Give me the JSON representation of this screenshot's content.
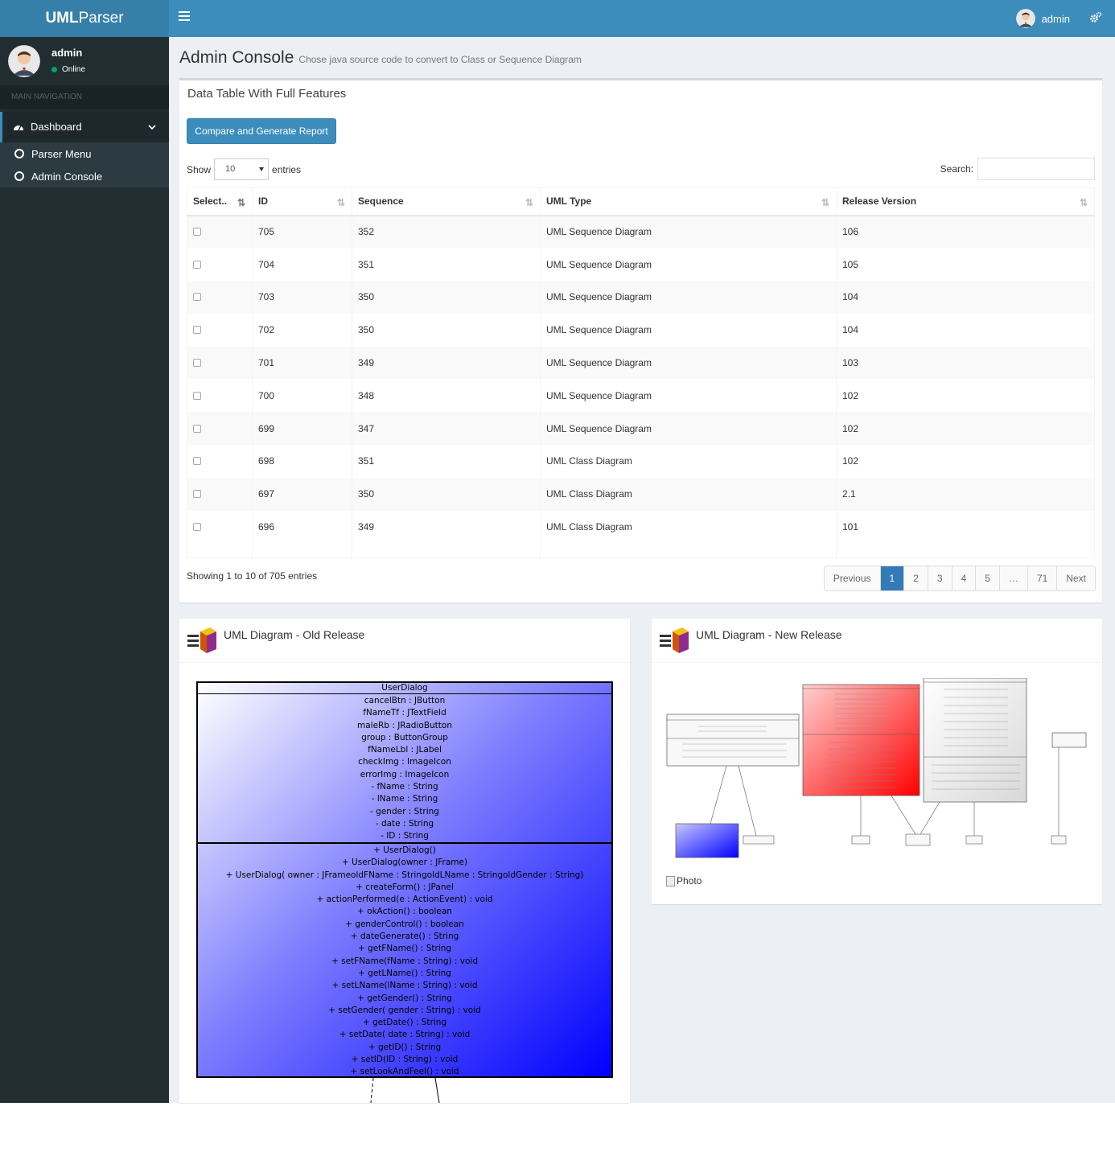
{
  "app": {
    "logo_bold": "UML",
    "logo_rest": "Parser"
  },
  "topbar": {
    "username": "admin"
  },
  "sidebar": {
    "username": "admin",
    "status": "Online",
    "nav_header": "MAIN NAVIGATION",
    "dashboard_label": "Dashboard",
    "items": [
      {
        "label": "Parser Menu"
      },
      {
        "label": "Admin Console"
      }
    ]
  },
  "page": {
    "title": "Admin Console",
    "subtitle": "Chose java source code to convert to Class or Sequence Diagram"
  },
  "datatable": {
    "title": "Data Table With Full Features",
    "compare_button": "Compare and Generate Report",
    "show_label": "Show",
    "entries_value": "10",
    "entries_label": "entries",
    "search_label": "Search:",
    "search_value": "",
    "columns": [
      "Select..",
      "ID",
      "Sequence",
      "UML Type",
      "Release Version"
    ],
    "rows": [
      {
        "id": "705",
        "sequence": "352",
        "uml_type": "UML Sequence Diagram",
        "release": "106"
      },
      {
        "id": "704",
        "sequence": "351",
        "uml_type": "UML Sequence Diagram",
        "release": "105"
      },
      {
        "id": "703",
        "sequence": "350",
        "uml_type": "UML Sequence Diagram",
        "release": "104"
      },
      {
        "id": "702",
        "sequence": "350",
        "uml_type": "UML Sequence Diagram",
        "release": "104"
      },
      {
        "id": "701",
        "sequence": "349",
        "uml_type": "UML Sequence Diagram",
        "release": "103"
      },
      {
        "id": "700",
        "sequence": "348",
        "uml_type": "UML Sequence Diagram",
        "release": "102"
      },
      {
        "id": "699",
        "sequence": "347",
        "uml_type": "UML Sequence Diagram",
        "release": "102"
      },
      {
        "id": "698",
        "sequence": "351",
        "uml_type": "UML Class Diagram",
        "release": "102"
      },
      {
        "id": "697",
        "sequence": "350",
        "uml_type": "UML Class Diagram",
        "release": "2.1"
      },
      {
        "id": "696",
        "sequence": "349",
        "uml_type": "UML Class Diagram",
        "release": "101"
      }
    ],
    "info": "Showing 1 to 10 of 705 entries",
    "pagination": [
      "Previous",
      "1",
      "2",
      "3",
      "4",
      "5",
      "…",
      "71",
      "Next"
    ]
  },
  "old_release": {
    "title": "UML Diagram - Old Release",
    "class_name": "UserDialog",
    "attributes": [
      "cancelBtn : JButton",
      "fNameTf : JTextField",
      "maleRb : JRadioButton",
      "group : ButtonGroup",
      "fNameLbl : JLabel",
      "checkImg : ImageIcon",
      "errorImg : ImageIcon",
      "- fName : String",
      "- lName : String",
      "- gender : String",
      "- date : String",
      "- ID : String"
    ],
    "operations": [
      "+ UserDialog()",
      "+ UserDialog(owner : JFrame)",
      "+ UserDialog( owner : JFrameoldFName : StringoldLName : StringoldGender : String)",
      "+ createForm() : JPanel",
      "+ actionPerformed(e : ActionEvent) : void",
      "+ okAction() : boolean",
      "+ genderControl() : boolean",
      "+ dateGenerate() : String",
      "+ getFName() : String",
      "+ setFName(fName : String) : void",
      "+ getLName() : String",
      "+ setLName(lName : String) : void",
      "+ getGender() : String",
      "+ setGender( gender : String) : void",
      "+ getDate() : String",
      "+ setDate( date : String) : void",
      "+ getID() : String",
      "+ setID(ID : String) : void",
      "+ setLookAndFeel() : void"
    ]
  },
  "new_release": {
    "title": "UML Diagram - New Release",
    "photo_alt": "Photo"
  },
  "colors": {
    "primary": "#3c8dbc",
    "sidebar": "#222d32",
    "content_bg": "#ecf0f5",
    "page_active": "#337ab7"
  }
}
